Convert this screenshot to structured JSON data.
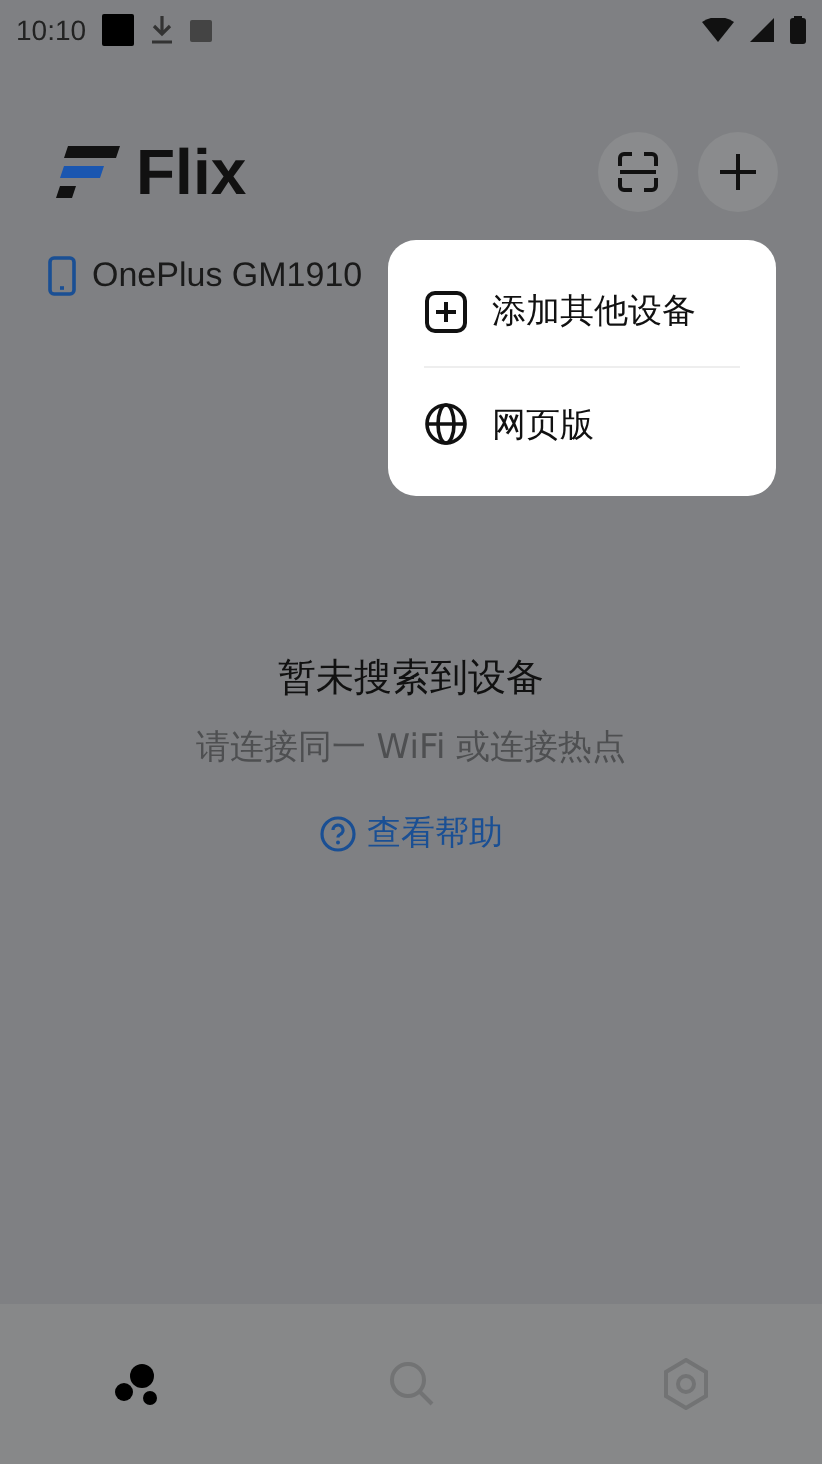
{
  "status_bar": {
    "time": "10:10"
  },
  "header": {
    "title": "Flix"
  },
  "device": {
    "name": "OnePlus GM1910"
  },
  "empty_state": {
    "title": "暂未搜索到设备",
    "hint": "请连接同一 WiFi 或连接热点",
    "help_link": "查看帮助"
  },
  "menu": {
    "items": [
      {
        "kind": "add",
        "label": "添加其他设备"
      },
      {
        "kind": "web",
        "label": "网页版"
      }
    ]
  },
  "bottom_nav": [
    {
      "kind": "devices",
      "selected": true
    },
    {
      "kind": "search",
      "selected": false
    },
    {
      "kind": "settings",
      "selected": false
    }
  ]
}
